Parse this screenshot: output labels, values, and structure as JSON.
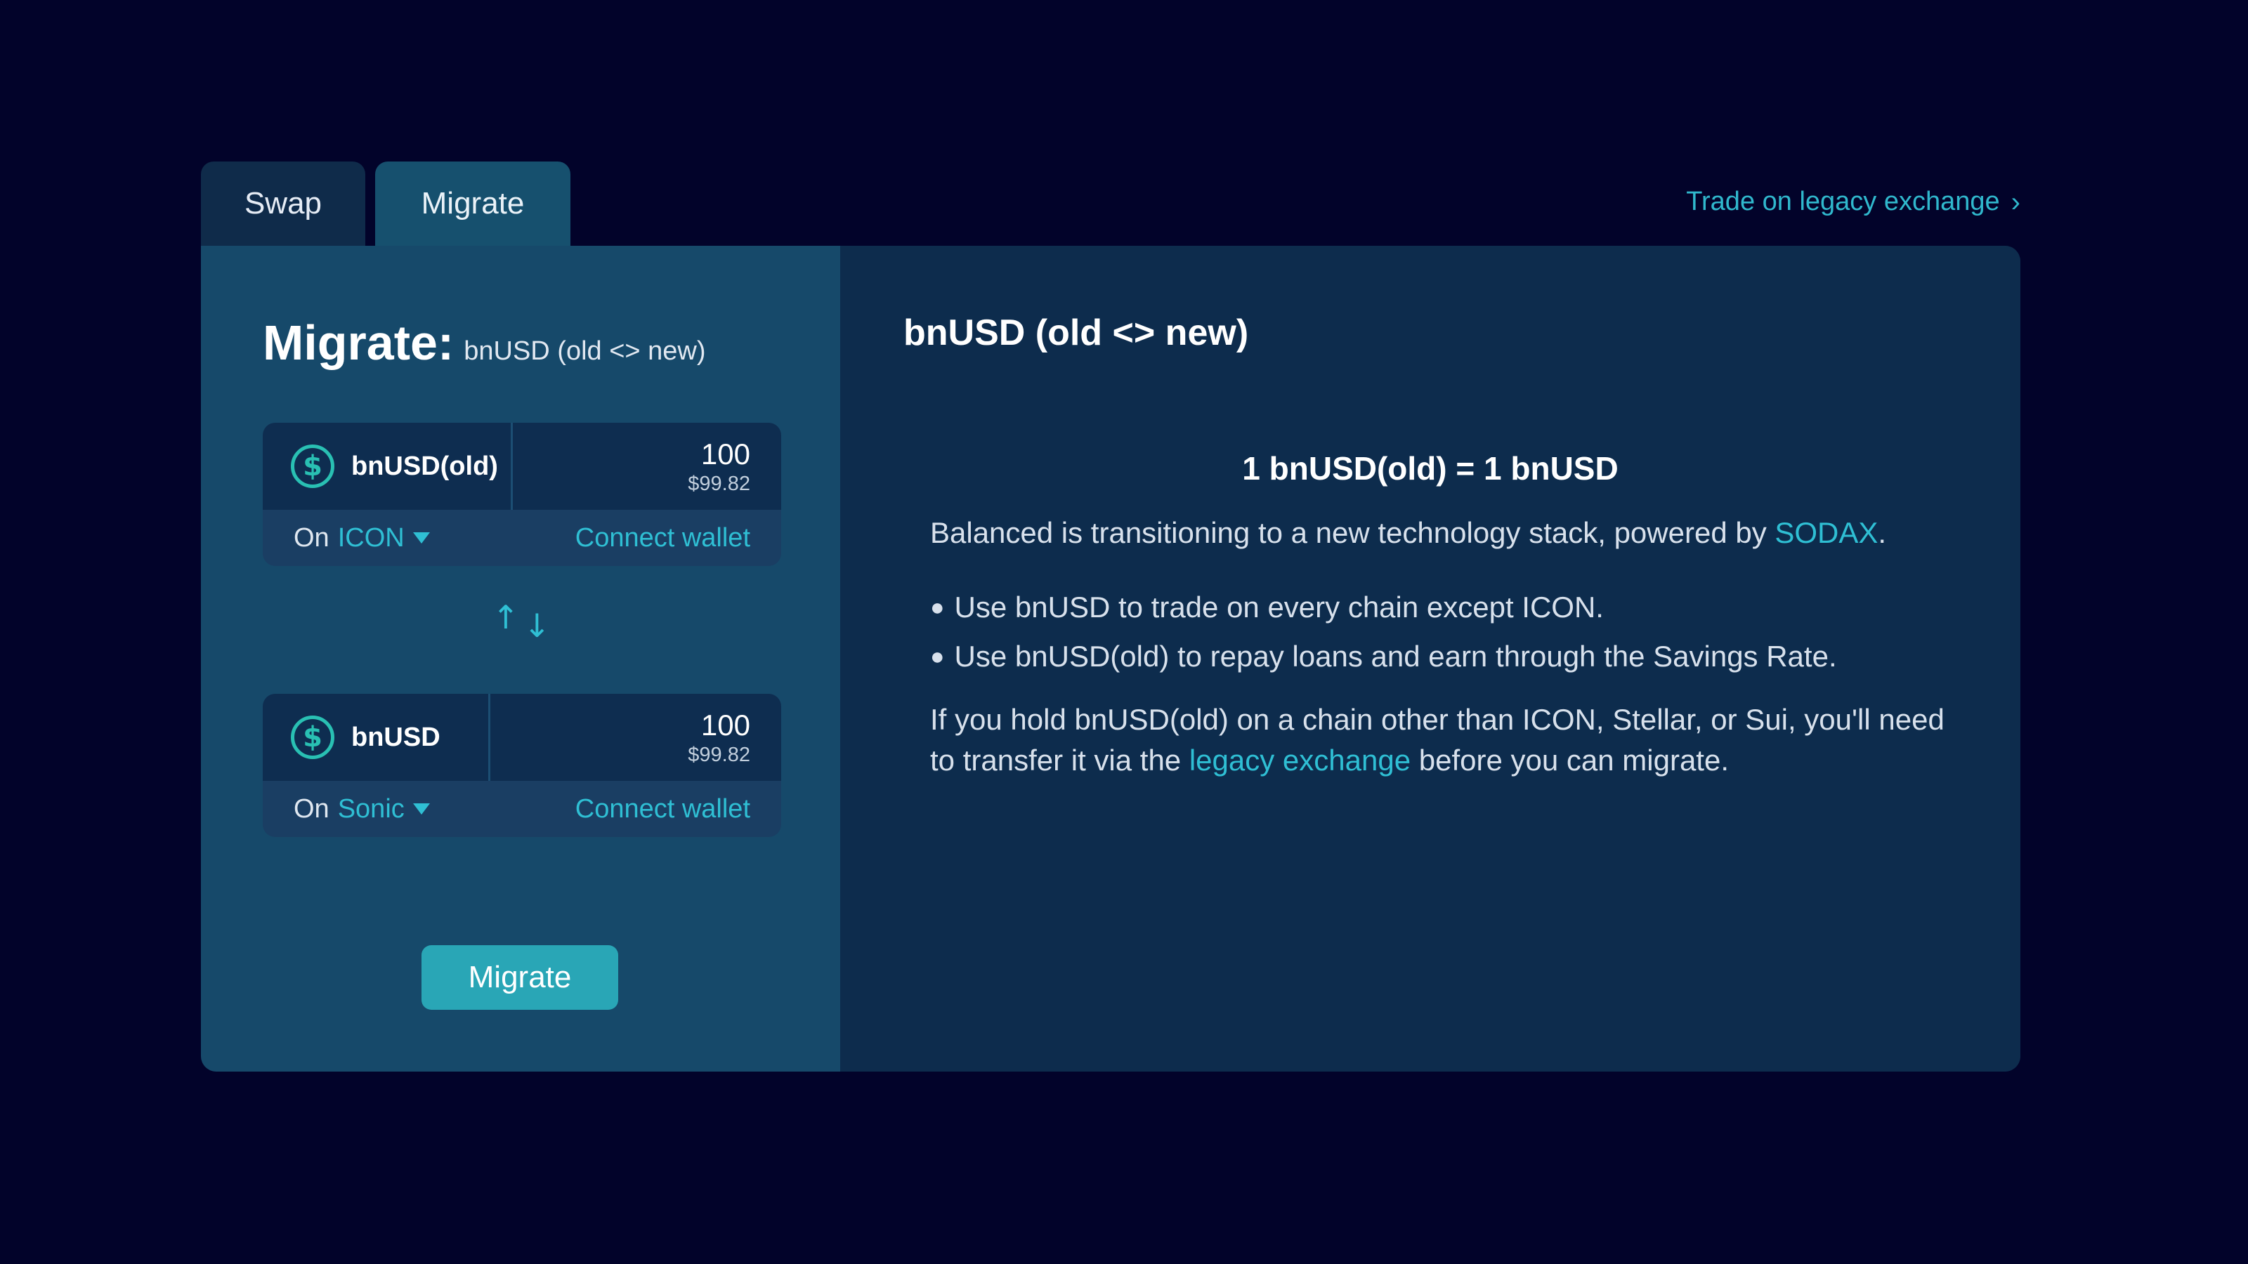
{
  "tabs": [
    {
      "label": "Swap"
    },
    {
      "label": "Migrate"
    }
  ],
  "legacy_link": {
    "label": "Trade on legacy exchange",
    "chevron": "›"
  },
  "left": {
    "title": "Migrate:",
    "subtitle": "bnUSD (old <> new)",
    "from": {
      "icon": "dollar-coin-icon",
      "token": "bnUSD(old)",
      "amount": "100",
      "usd": "$99.82",
      "on_label": "On",
      "chain": "ICON",
      "connect": "Connect wallet"
    },
    "to": {
      "icon": "dollar-coin-icon",
      "token": "bnUSD",
      "amount": "100",
      "usd": "$99.82",
      "on_label": "On",
      "chain": "Sonic",
      "connect": "Connect wallet"
    },
    "swap_arrows": {
      "up": "↑",
      "down": "↓"
    },
    "migrate_button": "Migrate"
  },
  "right": {
    "title": "bnUSD (old <> new)",
    "rate": "1 bnUSD(old) = 1 bnUSD",
    "intro_prefix": "Balanced is transitioning to a new technology stack, powered by ",
    "intro_link": "SODAX",
    "intro_suffix": ".",
    "bullets": [
      "Use bnUSD to trade on every chain except ICON.",
      "Use bnUSD(old) to repay loans and earn through the Savings Rate."
    ],
    "note_prefix": "If you hold bnUSD(old) on a chain other than ICON, Stellar, or Sui, you'll need to transfer it via the ",
    "note_link": "legacy exchange",
    "note_suffix": " before you can migrate."
  },
  "colors": {
    "background": "#02032a",
    "accent": "#2fbfd4",
    "left_panel": "#16496a",
    "right_panel": "#0d2c4d",
    "button": "#29a6b6"
  }
}
